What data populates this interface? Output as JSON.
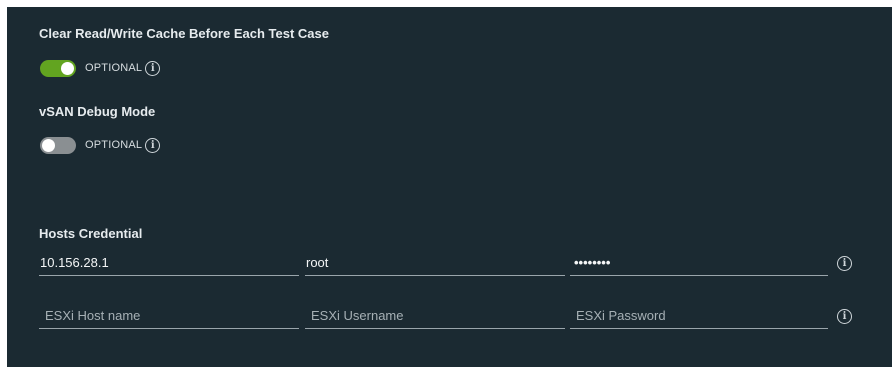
{
  "options": [
    {
      "title": "Clear Read/Write Cache Before Each Test Case",
      "enabled": true,
      "optional_label": "OPTIONAL",
      "info_glyph": "i"
    },
    {
      "title": "vSAN Debug Mode",
      "enabled": false,
      "optional_label": "OPTIONAL",
      "info_glyph": "i"
    }
  ],
  "hosts_credential": {
    "title": "Hosts Credential",
    "rows": [
      {
        "host": "10.156.28.1",
        "username": "root",
        "password": "••••••••"
      },
      {
        "host_placeholder": "ESXi Host name",
        "username_placeholder": "ESXi Username",
        "password_placeholder": "ESXi Password"
      }
    ],
    "info_glyph": "i"
  },
  "colors": {
    "panel_background": "#1b2a32",
    "toggle_on": "#62a420",
    "toggle_off": "#8a8f92"
  }
}
